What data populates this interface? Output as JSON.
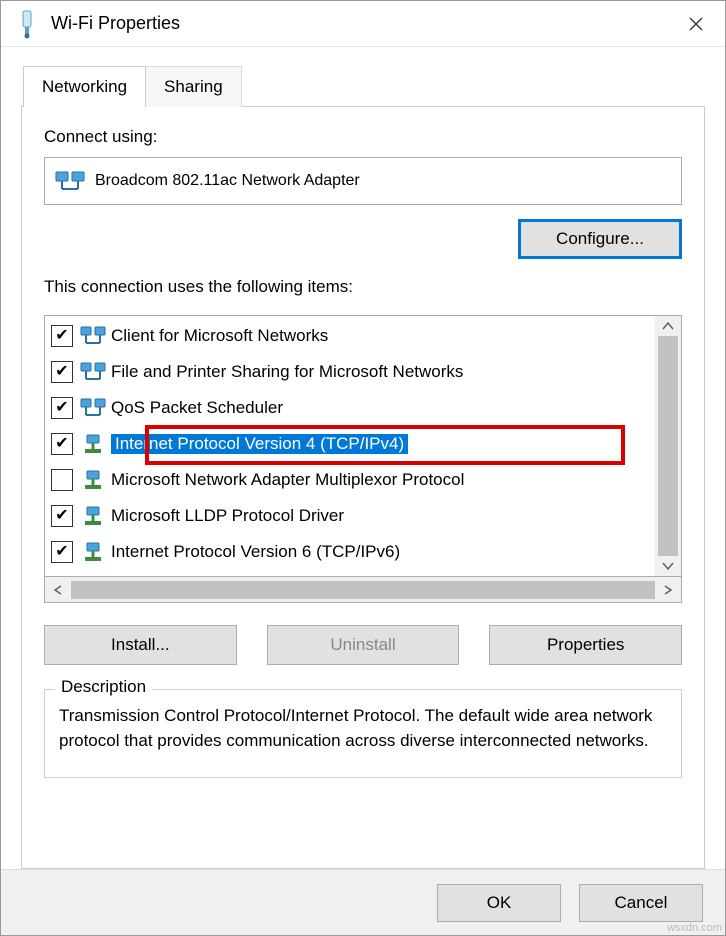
{
  "window": {
    "title": "Wi-Fi Properties"
  },
  "tabs": {
    "networking": "Networking",
    "sharing": "Sharing"
  },
  "labels": {
    "connect_using": "Connect using:",
    "items_label": "This connection uses the following items:",
    "description_legend": "Description"
  },
  "adapter": {
    "name": "Broadcom 802.11ac Network Adapter"
  },
  "buttons": {
    "configure": "Configure...",
    "install": "Install...",
    "uninstall": "Uninstall",
    "properties": "Properties",
    "ok": "OK",
    "cancel": "Cancel"
  },
  "items": [
    {
      "checked": true,
      "icon": "lan",
      "label": "Client for Microsoft Networks"
    },
    {
      "checked": true,
      "icon": "lan",
      "label": "File and Printer Sharing for Microsoft Networks"
    },
    {
      "checked": true,
      "icon": "lan",
      "label": "QoS Packet Scheduler"
    },
    {
      "checked": true,
      "icon": "proto",
      "label": "Internet Protocol Version 4 (TCP/IPv4)",
      "selected": true
    },
    {
      "checked": false,
      "icon": "proto",
      "label": "Microsoft Network Adapter Multiplexor Protocol"
    },
    {
      "checked": true,
      "icon": "proto",
      "label": "Microsoft LLDP Protocol Driver"
    },
    {
      "checked": true,
      "icon": "proto",
      "label": "Internet Protocol Version 6 (TCP/IPv6)"
    }
  ],
  "description": {
    "text": "Transmission Control Protocol/Internet Protocol. The default wide area network protocol that provides communication across diverse interconnected networks."
  },
  "watermark": "wsxdn.com"
}
